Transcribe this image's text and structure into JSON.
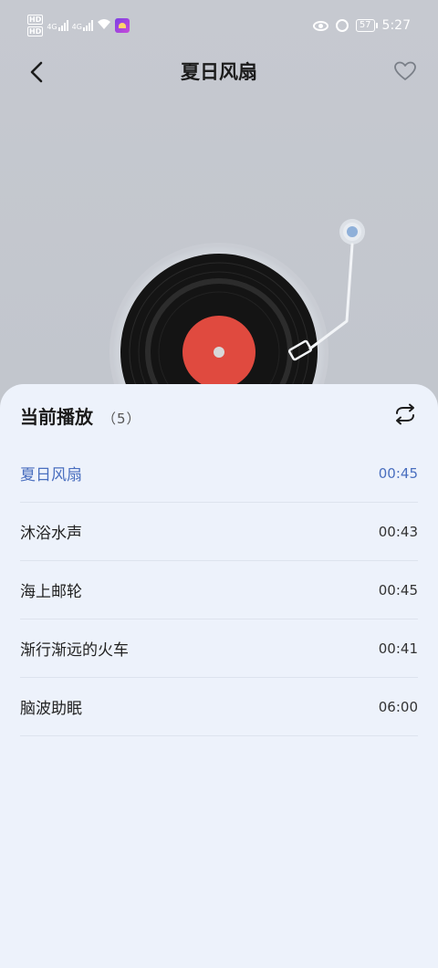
{
  "status_bar": {
    "hd1": "HD",
    "hd2": "HD",
    "net1": "4G",
    "net2": "4G",
    "battery": "57",
    "time": "5:27"
  },
  "header": {
    "title": "夏日风扇"
  },
  "colors": {
    "accent": "#4a6fbf",
    "record_label": "#e04a3f",
    "sheet_bg": "#edf2fb"
  },
  "playlist": {
    "title": "当前播放",
    "count": "（5）",
    "items": [
      {
        "name": "夏日风扇",
        "duration": "00:45",
        "active": true
      },
      {
        "name": "沐浴水声",
        "duration": "00:43",
        "active": false
      },
      {
        "name": "海上邮轮",
        "duration": "00:45",
        "active": false
      },
      {
        "name": "渐行渐远的火车",
        "duration": "00:41",
        "active": false
      },
      {
        "name": "脑波助眠",
        "duration": "06:00",
        "active": false
      }
    ]
  }
}
